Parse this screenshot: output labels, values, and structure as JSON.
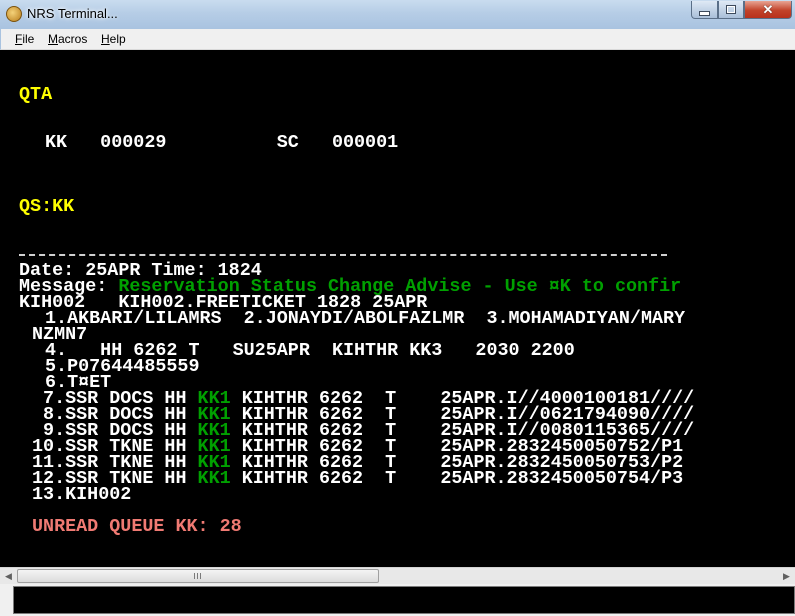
{
  "window": {
    "title": "NRS Terminal...",
    "controls": {
      "minimize": "",
      "maximize": "",
      "close": "✕"
    }
  },
  "menu": {
    "file": {
      "accel": "F",
      "rest": "ile"
    },
    "macros": {
      "accel": "M",
      "rest": "acros"
    },
    "help": {
      "accel": "H",
      "rest": "elp"
    }
  },
  "terminal": {
    "qta": "QTA",
    "counts": "KK   000029          SC   000001",
    "qs": "QS:KK",
    "date_line": "Date: 25APR Time: 1824",
    "message_label": "Message: ",
    "message_text": "Reservation Status Change Advise - Use ¤K to confir",
    "pnr_header": "KIH002   KIH002.FREETICKET 1828 25APR",
    "names": "1.AKBARI/LILAMRS  2.JONAYDI/ABOLFAZLMR  3.MOHAMADIYAN/MARY",
    "names_cont": "NZMN7",
    "segment": "4.   HH 6262 T   SU25APR  KIHTHR KK3   2030 2200",
    "phone": "5.P07644485559",
    "ticketing": "6.T¤ET",
    "ssr_rows": [
      {
        "num": " 7.",
        "type": "SSR DOCS HH ",
        "status": "KK1",
        "rest": " KIHTHR 6262  T    25APR.I//4000100181////"
      },
      {
        "num": " 8.",
        "type": "SSR DOCS HH ",
        "status": "KK1",
        "rest": " KIHTHR 6262  T    25APR.I//0621794090////"
      },
      {
        "num": " 9.",
        "type": "SSR DOCS HH ",
        "status": "KK1",
        "rest": " KIHTHR 6262  T    25APR.I//0080115365////"
      },
      {
        "num": "10.",
        "type": "SSR TKNE HH ",
        "status": "KK1",
        "rest": " KIHTHR 6262  T    25APR.2832450050752/P1"
      },
      {
        "num": "11.",
        "type": "SSR TKNE HH ",
        "status": "KK1",
        "rest": " KIHTHR 6262  T    25APR.2832450050753/P2"
      },
      {
        "num": "12.",
        "type": "SSR TKNE HH ",
        "status": "KK1",
        "rest": " KIHTHR 6262  T    25APR.2832450050754/P3"
      }
    ],
    "remark": "13.KIH002",
    "unread": "UNREAD QUEUE KK: 28"
  },
  "scrollbar": {
    "left_arrow": "◀",
    "right_arrow": "▶"
  },
  "command": {
    "value": ""
  },
  "colors": {
    "prompt": "#ffff00",
    "status_green": "#00a000",
    "alert": "#f07a73",
    "background": "#000000"
  }
}
